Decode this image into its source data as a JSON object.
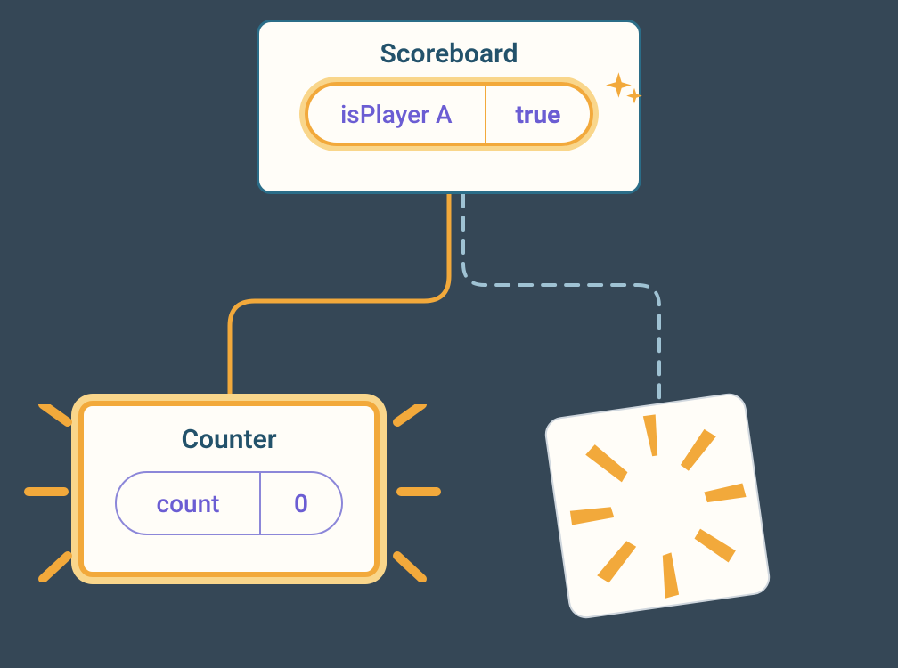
{
  "scoreboard": {
    "title": "Scoreboard",
    "pill_label": "isPlayer A",
    "pill_value": "true"
  },
  "counter": {
    "title": "Counter",
    "pill_label": "count",
    "pill_value": "0"
  },
  "colors": {
    "accent": "#F2A93B",
    "accent_glow": "#F9D68B",
    "border_blue": "#2B6D88",
    "text_blue": "#23526B",
    "purple": "#6B5DD3",
    "purple_border": "#8C87D9",
    "dashed": "#9FC2D3",
    "bg": "#354756",
    "card_bg": "#FFFDF8"
  },
  "edges": {
    "left": {
      "style": "solid",
      "active": true
    },
    "right": {
      "style": "dashed",
      "active": false
    }
  }
}
